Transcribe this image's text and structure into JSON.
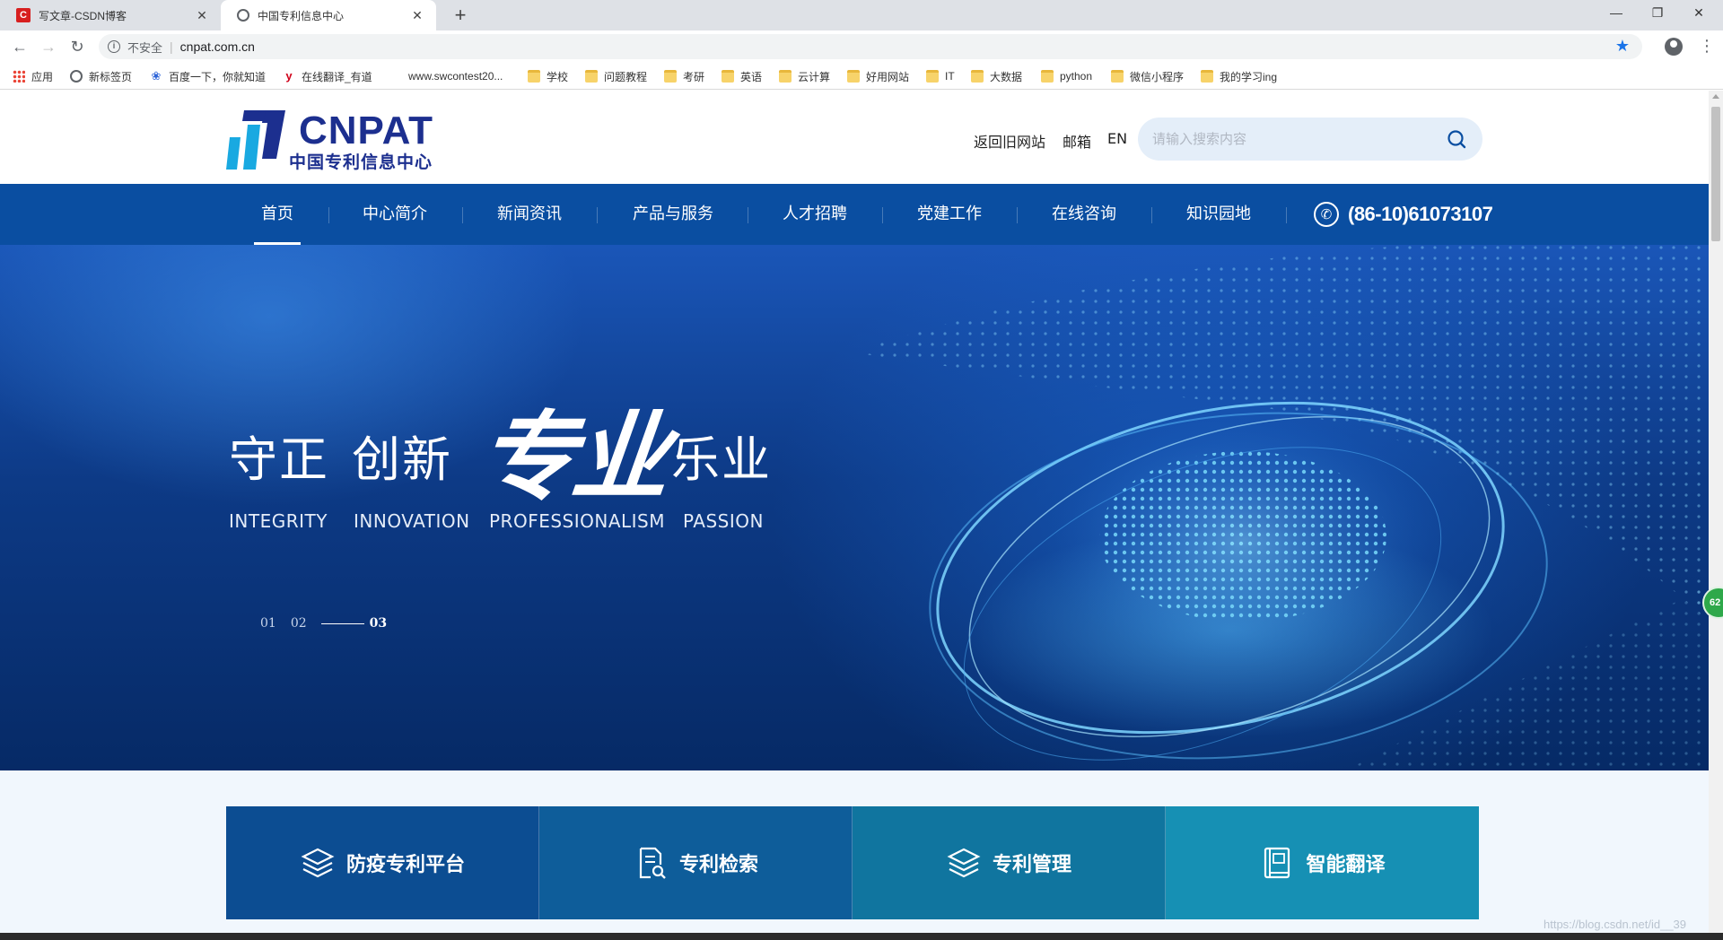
{
  "browser": {
    "tabs": [
      {
        "title": "写文章-CSDN博客",
        "favicon": "csdn-icon"
      },
      {
        "title": "中国专利信息中心",
        "favicon": "globe-icon"
      }
    ],
    "new_tab": "+",
    "window_controls": {
      "minimize": "—",
      "restore": "❐",
      "close": "✕"
    },
    "nav": {
      "back": "←",
      "forward": "→",
      "reload": "↻"
    },
    "address": {
      "security": "不安全",
      "separator": "|",
      "url": "cnpat.com.cn",
      "bookmark_star": "★"
    },
    "bookmarks": [
      {
        "label": "应用",
        "icon": "apps-icon"
      },
      {
        "label": "新标签页",
        "icon": "globe-icon"
      },
      {
        "label": "百度一下，你就知道",
        "icon": "baidu-icon"
      },
      {
        "label": "在线翻译_有道",
        "icon": "youdao-icon"
      },
      {
        "label": "www.swcontest20...",
        "icon": "none"
      },
      {
        "label": "学校",
        "icon": "folder-icon"
      },
      {
        "label": "问题教程",
        "icon": "folder-icon"
      },
      {
        "label": "考研",
        "icon": "folder-icon"
      },
      {
        "label": "英语",
        "icon": "folder-icon"
      },
      {
        "label": "云计算",
        "icon": "folder-icon"
      },
      {
        "label": "好用网站",
        "icon": "folder-icon"
      },
      {
        "label": "IT",
        "icon": "folder-icon"
      },
      {
        "label": "大数据",
        "icon": "folder-icon"
      },
      {
        "label": "python",
        "icon": "folder-icon"
      },
      {
        "label": "微信小程序",
        "icon": "folder-icon"
      },
      {
        "label": "我的学习ing",
        "icon": "folder-icon"
      }
    ]
  },
  "header": {
    "logo_text": "CNPAT",
    "logo_sub": "中国专利信息中心",
    "links": {
      "old_site": "返回旧网站",
      "mail": "邮箱",
      "lang": "EN"
    },
    "search_placeholder": "请输入搜索内容"
  },
  "nav": {
    "items": [
      "首页",
      "中心简介",
      "新闻资讯",
      "产品与服务",
      "人才招聘",
      "党建工作",
      "在线咨询",
      "知识园地"
    ],
    "active_index": 0,
    "phone": "(86-10)61073107"
  },
  "banner": {
    "slogan": [
      "守正",
      "创新",
      "专业",
      "乐业"
    ],
    "slogan_en": [
      "INTEGRITY",
      "INNOVATION",
      "PROFESSIONALISM",
      "PASSION"
    ],
    "pager": [
      "01",
      "02",
      "03"
    ],
    "current_slide": 3,
    "badge": "62"
  },
  "quick_links": [
    {
      "label": "防疫专利平台",
      "icon": "layers-icon",
      "color": "#0c4d92"
    },
    {
      "label": "专利检索",
      "icon": "document-search-icon",
      "color": "#0e5d9a"
    },
    {
      "label": "专利管理",
      "icon": "layers-icon",
      "color": "#10759f"
    },
    {
      "label": "智能翻译",
      "icon": "book-icon",
      "color": "#1690b4"
    }
  ],
  "watermark": "https://blog.csdn.net/id__39",
  "colors": {
    "nav_bg": "#0a4ea1",
    "logo": "#1c2f8f",
    "search_bg": "#e4eef9"
  }
}
